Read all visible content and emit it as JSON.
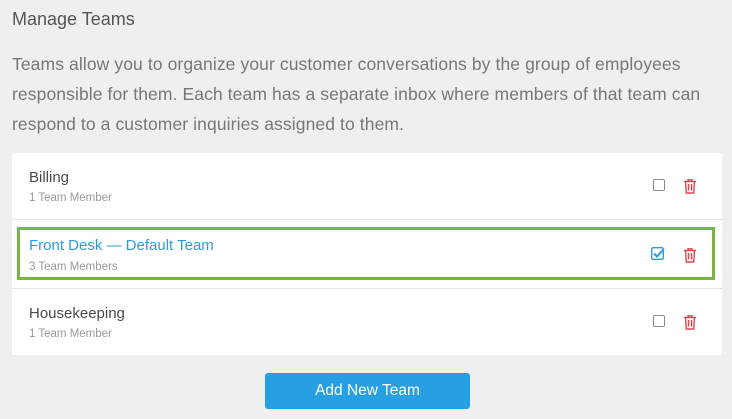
{
  "page": {
    "title": "Manage Teams",
    "description": "Teams allow you to organize your customer conversations by the group of employees responsible for them. Each team has a separate inbox where members of that team can respond to a customer inquiries assigned to them."
  },
  "teams": [
    {
      "name": "Billing",
      "members": "1 Team Member",
      "checked": false,
      "selected": false
    },
    {
      "name": "Front Desk — Default Team",
      "members": "3 Team Members",
      "checked": true,
      "selected": true
    },
    {
      "name": "Housekeeping",
      "members": "1 Team Member",
      "checked": false,
      "selected": false
    }
  ],
  "actions": {
    "add_label": "Add New Team"
  },
  "colors": {
    "accent": "#27a0e3",
    "selected_outline": "#77b842",
    "selected_text": "#2a9bdd",
    "delete_icon": "#e0434b",
    "background": "#efefef"
  },
  "icons": {
    "delete": "trash-icon",
    "select": "checkbox-icon"
  }
}
